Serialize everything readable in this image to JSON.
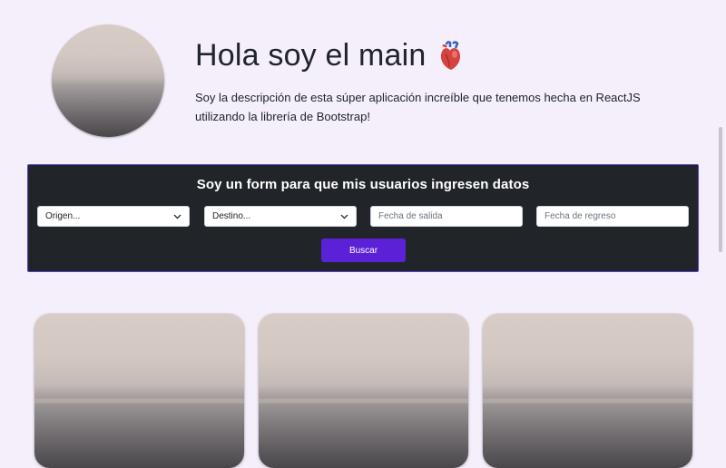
{
  "hero": {
    "title": "Hola soy el main",
    "title_icon": "anatomical-heart-icon",
    "description": "Soy la descripción de esta súper aplicación increíble que tenemos hecha en ReactJS utilizando la librería de Bootstrap!"
  },
  "form": {
    "title": "Soy un form para que mis usuarios ingresen datos",
    "origin_select": "Origen...",
    "destination_select": "Destino...",
    "departure_placeholder": "Fecha de salida",
    "return_placeholder": "Fecha de regreso",
    "search_button": "Buscar"
  },
  "colors": {
    "page_background": "#f5effb",
    "form_background": "#212529",
    "accent": "#5b21d6"
  }
}
